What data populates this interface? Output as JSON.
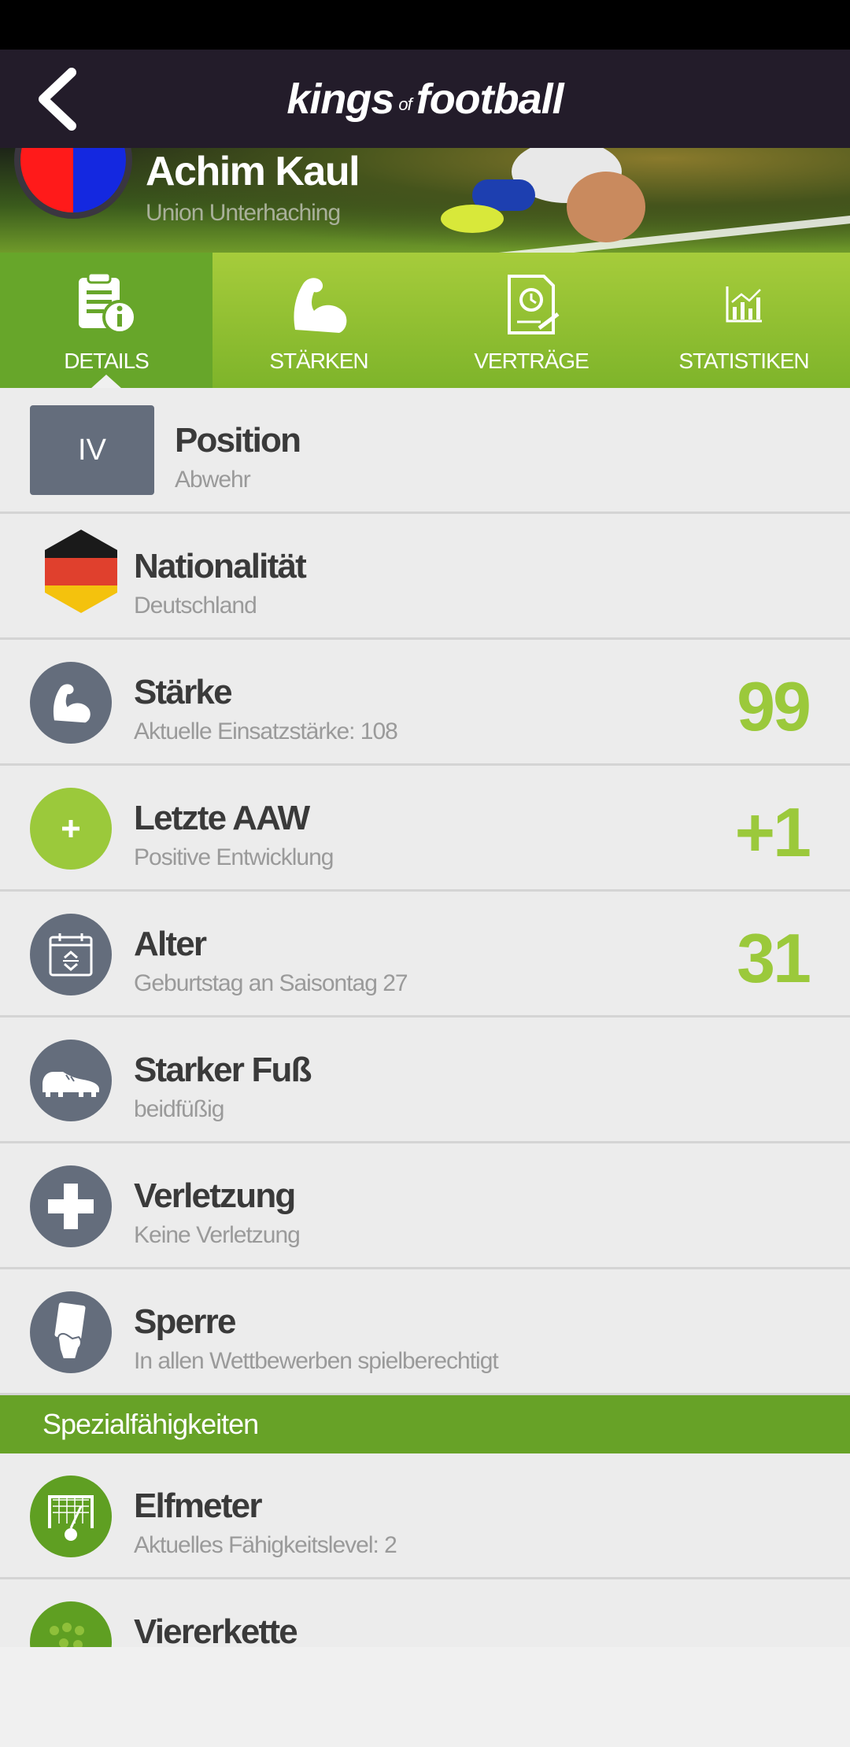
{
  "app": {
    "logo_word1": "kings",
    "logo_of": "of",
    "logo_word2": "football",
    "back_icon": "chevron-left-icon"
  },
  "player": {
    "name": "Achim Kaul",
    "club": "Union Unterhaching",
    "crest_colors": [
      "#ff1a1a",
      "#1428e0"
    ]
  },
  "tabs": [
    {
      "label": "DETAILS",
      "icon": "document-info-icon",
      "active": true
    },
    {
      "label": "STÄRKEN",
      "icon": "biceps-icon",
      "active": false
    },
    {
      "label": "VERTRÄGE",
      "icon": "contract-clock-icon",
      "active": false
    },
    {
      "label": "STATISTIKEN",
      "icon": "chart-icon",
      "active": false
    }
  ],
  "details": {
    "position": {
      "badge": "IV",
      "title": "Position",
      "sub": "Abwehr"
    },
    "nationality": {
      "title": "Nationalität",
      "sub": "Deutschland",
      "flag_colors": [
        "#1a1a1a",
        "#e0402d",
        "#f4c20d"
      ]
    },
    "strength": {
      "title": "Stärke",
      "sub": "Aktuelle Einsatzstärke: 108",
      "value": "99"
    },
    "last_aaw": {
      "title": "Letzte AAW",
      "sub": "Positive Entwicklung",
      "value": "+1"
    },
    "age": {
      "title": "Alter",
      "sub": "Geburtstag an Saisontag 27",
      "value": "31"
    },
    "foot": {
      "title": "Starker Fuß",
      "sub": "beidfüßig"
    },
    "injury": {
      "title": "Verletzung",
      "sub": "Keine Verletzung"
    },
    "ban": {
      "title": "Sperre",
      "sub": "In allen Wettbewerben spielberechtigt"
    }
  },
  "special": {
    "heading": "Spezialfähigkeiten",
    "items": [
      {
        "title": "Elfmeter",
        "sub": "Aktuelles Fähigkeitslevel: 2"
      },
      {
        "title": "Viererkette",
        "sub": ""
      }
    ]
  },
  "colors": {
    "accent_green": "#9bc93b",
    "icon_gray": "#646d7c",
    "header_dark": "#231c2a"
  }
}
